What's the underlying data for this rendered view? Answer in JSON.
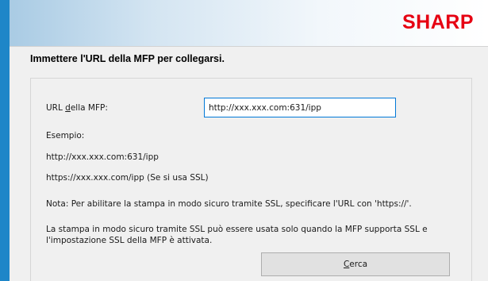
{
  "header": {
    "logo_text": "SHARP",
    "accent_color": "#1e86c8",
    "brand_color": "#e60012"
  },
  "title": "Immettere l'URL della MFP per collegarsi.",
  "form": {
    "url_label_pre": "URL ",
    "url_label_accel": "d",
    "url_label_post": "ella MFP:",
    "url_value": "http://xxx.xxx.com:631/ipp"
  },
  "example": {
    "heading": "Esempio:",
    "line1": "http://xxx.xxx.com:631/ipp",
    "line2": "https://xxx.xxx.com/ipp (Se si usa SSL)"
  },
  "notes": {
    "note1": "Nota: Per abilitare la stampa in modo sicuro tramite SSL, specificare l'URL con 'https://'.",
    "note2": "La stampa in modo sicuro tramite SSL può essere usata solo quando la MFP supporta SSL e l'impostazione SSL della MFP è attivata."
  },
  "search_button": {
    "accel": "C",
    "rest": "erca"
  }
}
